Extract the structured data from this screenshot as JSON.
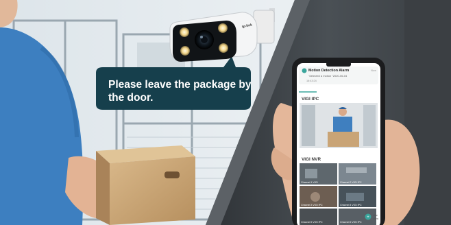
{
  "speech_bubble": {
    "text": "Please leave the package by the door."
  },
  "camera": {
    "brand": "tp-link"
  },
  "phone_app": {
    "notification": {
      "title": "Motion Detection Alarm",
      "time": "Now",
      "body": "\"detected a motion \"2020-06-04",
      "sub": "16:43:24"
    },
    "sections": [
      {
        "label": "VIGI IPC"
      },
      {
        "label": "VIGI NVR"
      }
    ],
    "nvr_tiles": [
      {
        "label": "Channel 1 VIGI"
      },
      {
        "label": "Channel 2 VIGI IPC"
      },
      {
        "label": "Channel 3 VIGI IPC"
      },
      {
        "label": "Channel 4 VIGI IPC"
      },
      {
        "label": "Channel 5 VIGI IPC"
      },
      {
        "label": "Channel 6 VIGI IPC"
      }
    ],
    "fab": {
      "label_1": "Live",
      "label_2": "View"
    }
  },
  "colors": {
    "bubble": "#163f4c",
    "app_accent": "#3aa59c",
    "courier_shirt": "#3d7fc0",
    "box": "#c9a476"
  }
}
